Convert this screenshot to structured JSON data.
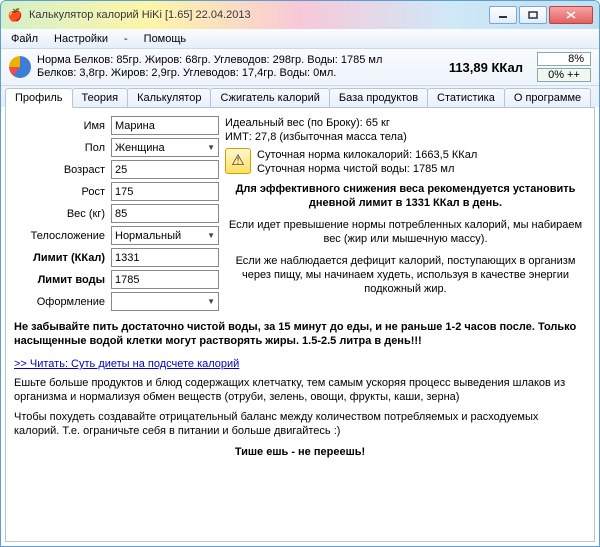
{
  "window": {
    "title": "Калькулятор калорий HiKi [1.65] 22.04.2013"
  },
  "menu": {
    "file": "Файл",
    "settings": "Настройки",
    "dash": "-",
    "help": "Помощь"
  },
  "norms": {
    "line1": "Норма Белков: 85гр. Жиров: 68гр. Углеводов: 298гр. Воды: 1785 мл",
    "line2": "Белков: 3,8гр. Жиров: 2,9гр. Углеводов: 17,4гр. Воды: 0мл.",
    "kcal": "113,89 ККал",
    "pct": "8%",
    "plus": "0% ++"
  },
  "tabs": {
    "profile": "Профиль",
    "theory": "Теория",
    "calc": "Калькулятор",
    "burner": "Сжигатель калорий",
    "db": "База продуктов",
    "stats": "Статистика",
    "about": "О программе"
  },
  "form": {
    "name_lbl": "Имя",
    "name": "Марина",
    "sex_lbl": "Пол",
    "sex": "Женщина",
    "age_lbl": "Возраст",
    "age": "25",
    "height_lbl": "Рост",
    "height": "175",
    "weight_lbl": "Вес (кг)",
    "weight": "85",
    "body_lbl": "Телосложение",
    "body": "Нормальный",
    "limit_lbl": "Лимит (ККал)",
    "limit": "1331",
    "water_lbl": "Лимит воды",
    "water": "1785",
    "theme_lbl": "Оформление",
    "theme": ""
  },
  "info": {
    "ideal": "Идеальный вес (по Броку): 65 кг",
    "bmi": "ИМТ: 27,8 (избыточная масса тела)",
    "daily_kcal": "Суточная норма килокалорий: 1663,5 ККал",
    "daily_water": "Суточная норма чистой воды: 1785 мл",
    "recommend": "Для эффективного снижения веса рекомендуется установить дневной лимит в 1331 ККал в день.",
    "p1": "Если идет превышение нормы потребленных калорий, мы набираем вес (жир или мышечную массу).",
    "p2": "Если же наблюдается дефицит калорий, поступающих в организм через пищу, мы начинаем худеть, используя в качестве энергии подкожный жир."
  },
  "warn": "Не забывайте пить достаточно чистой воды, за 15 минут до еды, и не раньше 1-2 часов после. Только насыщенные водой клетки могут растворять жиры. 1.5-2.5 литра в день!!!",
  "link": ">>  Читать: Суть диеты на подсчете калорий",
  "tips": {
    "t1": "Ешьте больше продуктов и блюд содержащих клетчатку, тем самым ускоряя процесс выведения шлаков из организма и нормализуя обмен веществ (отруби, зелень, овощи, фрукты, каши, зерна)",
    "t2": "Чтобы похудеть создавайте отрицательный баланс между количеством потребляемых и расходуемых калорий. Т.е. ограничьте себя в питании и больше двигайтесь :)"
  },
  "final": "Тише ешь - не переешь!"
}
